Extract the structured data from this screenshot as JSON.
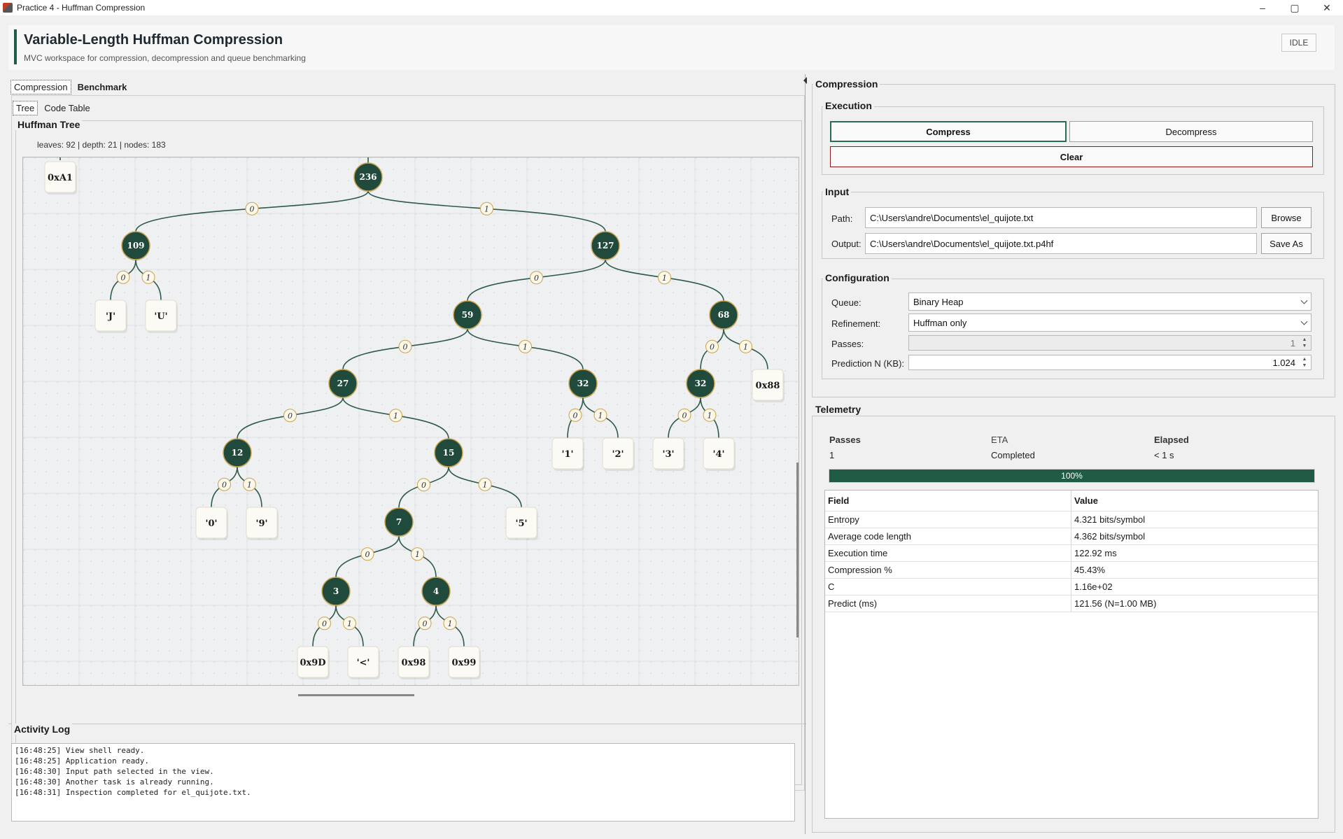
{
  "window": {
    "title": "Practice 4 - Huffman Compression",
    "minimize": "–",
    "maximize": "▢",
    "close": "✕"
  },
  "header": {
    "title": "Variable-Length Huffman Compression",
    "subtitle": "MVC workspace for compression, decompression and queue benchmarking",
    "status": "IDLE"
  },
  "main_tabs": [
    "Compression",
    "Benchmark"
  ],
  "view_tabs": [
    "Tree",
    "Code Table"
  ],
  "tree_panel": {
    "title": "Huffman Tree",
    "meta": "leaves: 92 | depth: 21 | nodes: 183",
    "nodes": [
      {
        "label": "236",
        "kind": "internal"
      },
      {
        "label": "109",
        "kind": "internal"
      },
      {
        "label": "127",
        "kind": "internal"
      },
      {
        "label": "59",
        "kind": "internal"
      },
      {
        "label": "68",
        "kind": "internal"
      },
      {
        "label": "27",
        "kind": "internal"
      },
      {
        "label": "32",
        "kind": "internal"
      },
      {
        "label": "32",
        "kind": "internal"
      },
      {
        "label": "12",
        "kind": "internal"
      },
      {
        "label": "15",
        "kind": "internal"
      },
      {
        "label": "7",
        "kind": "internal"
      },
      {
        "label": "3",
        "kind": "internal"
      },
      {
        "label": "4",
        "kind": "internal"
      },
      {
        "label": "0xA1",
        "kind": "leaf"
      },
      {
        "label": "'J'",
        "kind": "leaf"
      },
      {
        "label": "'U'",
        "kind": "leaf"
      },
      {
        "label": "0x88",
        "kind": "leaf"
      },
      {
        "label": "'1'",
        "kind": "leaf"
      },
      {
        "label": "'2'",
        "kind": "leaf"
      },
      {
        "label": "'3'",
        "kind": "leaf"
      },
      {
        "label": "'4'",
        "kind": "leaf"
      },
      {
        "label": "'0'",
        "kind": "leaf"
      },
      {
        "label": "'9'",
        "kind": "leaf"
      },
      {
        "label": "'5'",
        "kind": "leaf"
      },
      {
        "label": "0x9D",
        "kind": "leaf"
      },
      {
        "label": "'<'",
        "kind": "leaf"
      },
      {
        "label": "0x98",
        "kind": "leaf"
      },
      {
        "label": "0x99",
        "kind": "leaf"
      }
    ],
    "edge_label_zero": "0",
    "edge_label_one": "1"
  },
  "activity_log": {
    "title": "Activity Log",
    "lines": [
      "[16:48:25] View shell ready.",
      "[16:48:25] Application ready.",
      "[16:48:30] Input path selected in the view.",
      "[16:48:30] Another task is already running.",
      "[16:48:31] Inspection completed for el_quijote.txt."
    ]
  },
  "compression": {
    "title": "Compression",
    "execution": {
      "title": "Execution",
      "compress": "Compress",
      "decompress": "Decompress",
      "clear": "Clear"
    },
    "input": {
      "title": "Input",
      "path_label": "Path:",
      "path_value": "C:\\Users\\andre\\Documents\\el_quijote.txt",
      "browse": "Browse",
      "output_label": "Output:",
      "output_value": "C:\\Users\\andre\\Documents\\el_quijote.txt.p4hf",
      "save_as": "Save As"
    },
    "configuration": {
      "title": "Configuration",
      "queue_label": "Queue:",
      "queue_value": "Binary Heap",
      "refinement_label": "Refinement:",
      "refinement_value": "Huffman only",
      "passes_label": "Passes:",
      "passes_value": "1",
      "prediction_label": "Prediction N (KB):",
      "prediction_value": "1.024"
    }
  },
  "telemetry": {
    "title": "Telemetry",
    "passes_header": "Passes",
    "passes_value": "1",
    "eta_header": "ETA",
    "eta_value": "Completed",
    "elapsed_header": "Elapsed",
    "elapsed_value": "< 1 s",
    "progress": 1.0,
    "progress_label": "100%",
    "table_headers": [
      "Field",
      "Value"
    ],
    "rows": [
      [
        "Entropy",
        "4.321 bits/symbol"
      ],
      [
        "Average code length",
        "4.362 bits/symbol"
      ],
      [
        "Execution time",
        "122.92 ms"
      ],
      [
        "Compression %",
        "45.43%"
      ],
      [
        "C",
        "1.16e+02"
      ],
      [
        "Predict (ms)",
        "121.56 (N=1.00 MB)"
      ]
    ]
  },
  "colors": {
    "node_fill": "#1f4a3c",
    "node_stroke": "#c9a24a",
    "edge": "#2f5a4a",
    "leaf_fill": "#fbfaf5",
    "accent": "#1f5b45"
  }
}
